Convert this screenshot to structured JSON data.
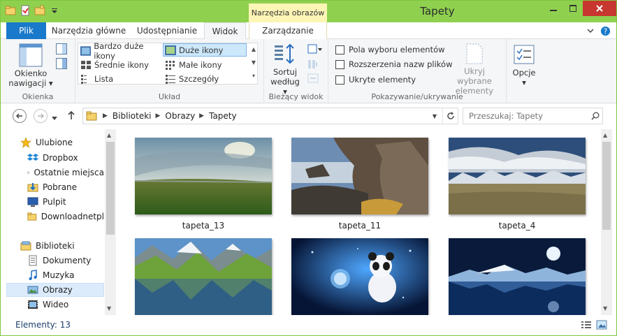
{
  "window": {
    "title": "Tapety",
    "context_tab_group": "Narzędzia obrazów"
  },
  "tabs": {
    "file": "Plik",
    "home": "Narzędzia główne",
    "share": "Udostępnianie",
    "view": "Widok",
    "manage": "Zarządzanie"
  },
  "ribbon": {
    "panes": {
      "nav_pane_label_1": "Okienko",
      "nav_pane_label_2": "nawigacji",
      "group_label": "Okienka"
    },
    "layout": {
      "group_label": "Układ",
      "items": [
        {
          "label": "Bardzo duże ikony",
          "selected": false
        },
        {
          "label": "Duże ikony",
          "selected": true
        },
        {
          "label": "Średnie ikony",
          "selected": false
        },
        {
          "label": "Małe ikony",
          "selected": false
        },
        {
          "label": "Lista",
          "selected": false
        },
        {
          "label": "Szczegóły",
          "selected": false
        }
      ]
    },
    "current_view": {
      "sort_label_1": "Sortuj",
      "sort_label_2": "według",
      "group_label": "Bieżący widok"
    },
    "show_hide": {
      "group_label": "Pokazywanie/ukrywanie",
      "checkboxes": [
        {
          "label": "Pola wyboru elementów",
          "checked": false
        },
        {
          "label": "Rozszerzenia nazw plików",
          "checked": false
        },
        {
          "label": "Ukryte elementy",
          "checked": false
        }
      ],
      "hide_selected_1": "Ukryj wybrane",
      "hide_selected_2": "elementy"
    },
    "options": {
      "label": "Opcje"
    }
  },
  "address": {
    "crumbs": [
      "Biblioteki",
      "Obrazy",
      "Tapety"
    ]
  },
  "search": {
    "placeholder": "Przeszukaj: Tapety"
  },
  "nav_pane": {
    "items": [
      {
        "label": "Ulubione",
        "icon": "star-icon"
      },
      {
        "label": "Dropbox",
        "icon": "dropbox-icon"
      },
      {
        "label": "Ostatnie miejsca",
        "icon": "recent-places-icon"
      },
      {
        "label": "Pobrane",
        "icon": "download-folder-icon"
      },
      {
        "label": "Pulpit",
        "icon": "desktop-icon"
      },
      {
        "label": "Downloadnetpl",
        "icon": "folder-icon"
      },
      {
        "label": "Biblioteki",
        "icon": "libraries-icon"
      },
      {
        "label": "Dokumenty",
        "icon": "documents-icon"
      },
      {
        "label": "Muzyka",
        "icon": "music-icon"
      },
      {
        "label": "Obrazy",
        "icon": "pictures-icon"
      },
      {
        "label": "Wideo",
        "icon": "video-icon"
      }
    ]
  },
  "files": [
    {
      "name": "tapeta_13"
    },
    {
      "name": "tapeta_11"
    },
    {
      "name": "tapeta_4"
    },
    {
      "name": ""
    },
    {
      "name": ""
    },
    {
      "name": ""
    }
  ],
  "status": {
    "items_count": "Elementy: 13"
  },
  "colors": {
    "titlebar": "#8fd14f",
    "file_tab": "#1979ca",
    "context_tab": "#fdf5b6",
    "selection": "#cde8fb"
  }
}
